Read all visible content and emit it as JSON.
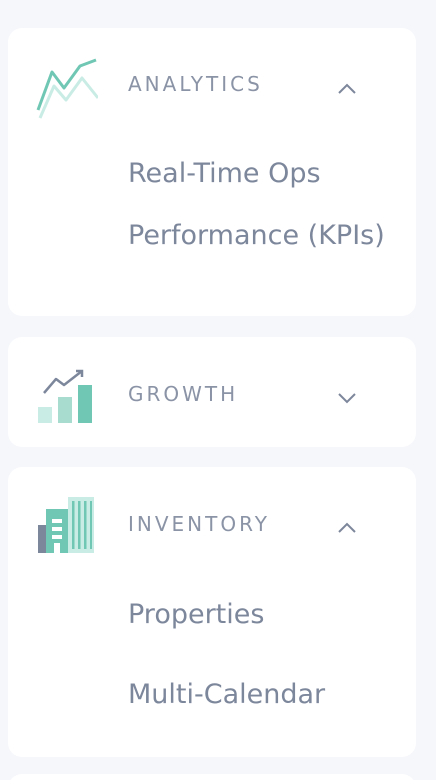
{
  "sections": [
    {
      "title": "ANALYTICS",
      "icon": "line-chart-icon",
      "expanded": true,
      "chevron": "chevron-up-icon",
      "items": [
        {
          "label": "Real-Time Ops"
        },
        {
          "label": "Performance (KPIs)"
        }
      ]
    },
    {
      "title": "GROWTH",
      "icon": "growth-bars-icon",
      "expanded": false,
      "chevron": "chevron-down-icon",
      "items": []
    },
    {
      "title": "INVENTORY",
      "icon": "buildings-icon",
      "expanded": true,
      "chevron": "chevron-up-icon",
      "items": [
        {
          "label": "Properties"
        },
        {
          "label": "Multi-Calendar"
        }
      ]
    }
  ],
  "colors": {
    "background": "#f6f7fb",
    "card": "#ffffff",
    "text_muted": "#8a94a6",
    "teal": "#6fc7b4",
    "teal_light": "#c9ece4",
    "slate": "#7d879c"
  }
}
